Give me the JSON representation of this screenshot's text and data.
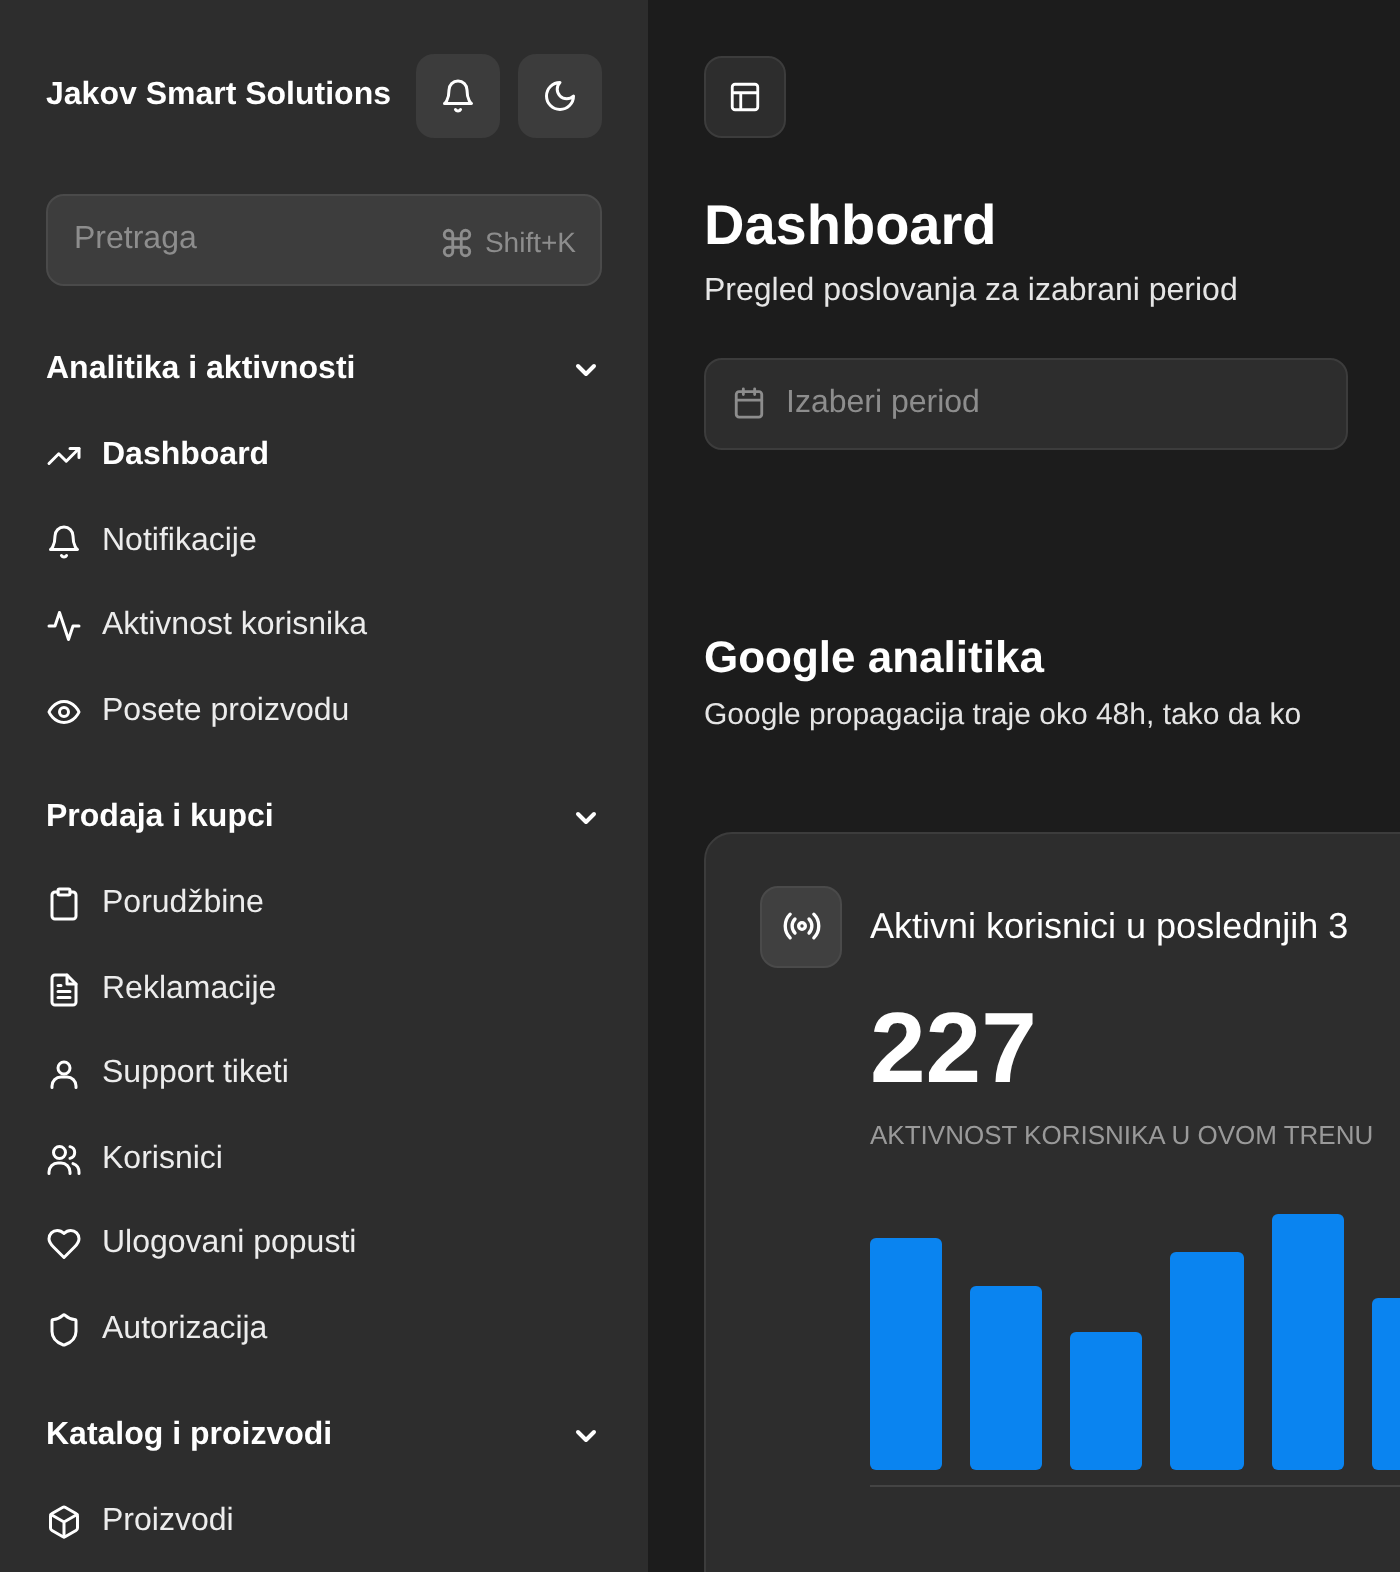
{
  "sidebar": {
    "title": "Jakov Smart Solutions",
    "search": {
      "placeholder": "Pretraga",
      "shortcut": "Shift+K"
    },
    "sections": [
      {
        "label": "Analitika i aktivnosti",
        "expanded": true,
        "items": [
          {
            "label": "Dashboard",
            "selected": true
          },
          {
            "label": "Notifikacije",
            "selected": false
          },
          {
            "label": "Aktivnost korisnika",
            "selected": false
          },
          {
            "label": "Posete proizvodu",
            "selected": false
          }
        ]
      },
      {
        "label": "Prodaja i kupci",
        "expanded": true,
        "items": [
          {
            "label": "Porudžbine",
            "selected": false
          },
          {
            "label": "Reklamacije",
            "selected": false
          },
          {
            "label": "Support tiketi",
            "selected": false
          },
          {
            "label": "Korisnici",
            "selected": false
          },
          {
            "label": "Ulogovani popusti",
            "selected": false
          },
          {
            "label": "Autorizacija",
            "selected": false
          }
        ]
      },
      {
        "label": "Katalog i proizvodi",
        "expanded": true,
        "items": [
          {
            "label": "Proizvodi",
            "selected": false
          }
        ]
      }
    ]
  },
  "main": {
    "title": "Dashboard",
    "subtitle": "Pregled poslovanja za izabrani period",
    "period_field": {
      "placeholder": "Izaberi period"
    },
    "section_title": "Google analitika",
    "section_note": "Google propagacija traje oko 48h, tako da ko",
    "card": {
      "title": "Aktivni korisnici u poslednjih 3",
      "value": "227",
      "caption": "AKTIVNOST KORISNIKA U OVOM TRENU"
    }
  }
}
